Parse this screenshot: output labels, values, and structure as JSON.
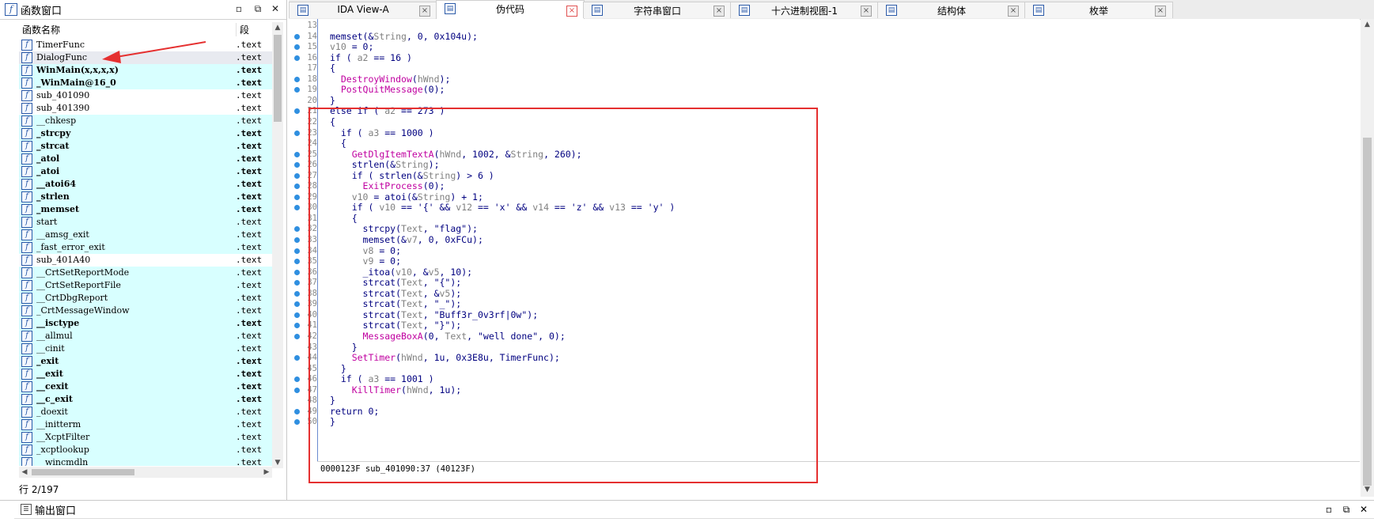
{
  "function_panel": {
    "title": "函数窗口",
    "columns": {
      "name": "函数名称",
      "segment": "段"
    },
    "status": "行 2/197",
    "functions": [
      {
        "name": "TimerFunc",
        "segment": ".text",
        "bold": false,
        "highlight": false,
        "selected": false
      },
      {
        "name": "DialogFunc",
        "segment": ".text",
        "bold": false,
        "highlight": false,
        "selected": true
      },
      {
        "name": "WinMain(x,x,x,x)",
        "segment": ".text",
        "bold": true,
        "highlight": true,
        "selected": false
      },
      {
        "name": "_WinMain@16_0",
        "segment": ".text",
        "bold": true,
        "highlight": true,
        "selected": false
      },
      {
        "name": "sub_401090",
        "segment": ".text",
        "bold": false,
        "highlight": false,
        "selected": false
      },
      {
        "name": "sub_401390",
        "segment": ".text",
        "bold": false,
        "highlight": false,
        "selected": false
      },
      {
        "name": "__chkesp",
        "segment": ".text",
        "bold": false,
        "highlight": true,
        "selected": false
      },
      {
        "name": "_strcpy",
        "segment": ".text",
        "bold": true,
        "highlight": true,
        "selected": false
      },
      {
        "name": "_strcat",
        "segment": ".text",
        "bold": true,
        "highlight": true,
        "selected": false
      },
      {
        "name": "_atol",
        "segment": ".text",
        "bold": true,
        "highlight": true,
        "selected": false
      },
      {
        "name": "_atoi",
        "segment": ".text",
        "bold": true,
        "highlight": true,
        "selected": false
      },
      {
        "name": "__atoi64",
        "segment": ".text",
        "bold": true,
        "highlight": true,
        "selected": false
      },
      {
        "name": "_strlen",
        "segment": ".text",
        "bold": true,
        "highlight": true,
        "selected": false
      },
      {
        "name": "_memset",
        "segment": ".text",
        "bold": true,
        "highlight": true,
        "selected": false
      },
      {
        "name": "start",
        "segment": ".text",
        "bold": false,
        "highlight": true,
        "selected": false
      },
      {
        "name": "__amsg_exit",
        "segment": ".text",
        "bold": false,
        "highlight": true,
        "selected": false
      },
      {
        "name": "_fast_error_exit",
        "segment": ".text",
        "bold": false,
        "highlight": true,
        "selected": false
      },
      {
        "name": "sub_401A40",
        "segment": ".text",
        "bold": false,
        "highlight": false,
        "selected": false
      },
      {
        "name": "__CrtSetReportMode",
        "segment": ".text",
        "bold": false,
        "highlight": true,
        "selected": false
      },
      {
        "name": "__CrtSetReportFile",
        "segment": ".text",
        "bold": false,
        "highlight": true,
        "selected": false
      },
      {
        "name": "__CrtDbgReport",
        "segment": ".text",
        "bold": false,
        "highlight": true,
        "selected": false
      },
      {
        "name": "_CrtMessageWindow",
        "segment": ".text",
        "bold": false,
        "highlight": true,
        "selected": false
      },
      {
        "name": "__isctype",
        "segment": ".text",
        "bold": true,
        "highlight": true,
        "selected": false
      },
      {
        "name": "__allmul",
        "segment": ".text",
        "bold": false,
        "highlight": true,
        "selected": false
      },
      {
        "name": "__cinit",
        "segment": ".text",
        "bold": false,
        "highlight": true,
        "selected": false
      },
      {
        "name": "_exit",
        "segment": ".text",
        "bold": true,
        "highlight": true,
        "selected": false
      },
      {
        "name": "__exit",
        "segment": ".text",
        "bold": true,
        "highlight": true,
        "selected": false
      },
      {
        "name": "__cexit",
        "segment": ".text",
        "bold": true,
        "highlight": true,
        "selected": false
      },
      {
        "name": "__c_exit",
        "segment": ".text",
        "bold": true,
        "highlight": true,
        "selected": false
      },
      {
        "name": "_doexit",
        "segment": ".text",
        "bold": false,
        "highlight": true,
        "selected": false
      },
      {
        "name": "__initterm",
        "segment": ".text",
        "bold": false,
        "highlight": true,
        "selected": false
      },
      {
        "name": "__XcptFilter",
        "segment": ".text",
        "bold": false,
        "highlight": true,
        "selected": false
      },
      {
        "name": "_xcptlookup",
        "segment": ".text",
        "bold": false,
        "highlight": true,
        "selected": false
      },
      {
        "name": "__wincmdln",
        "segment": ".text",
        "bold": false,
        "highlight": true,
        "selected": false
      }
    ]
  },
  "tabs": [
    {
      "label": "IDA View-A",
      "icon": "ida-view-icon",
      "active": false
    },
    {
      "label": "伪代码",
      "icon": "pseudocode-icon",
      "active": true
    },
    {
      "label": "字符串窗口",
      "icon": "strings-icon",
      "active": false
    },
    {
      "label": "十六进制视图-1",
      "icon": "hex-view-icon",
      "active": false
    },
    {
      "label": "结构体",
      "icon": "structures-icon",
      "active": false
    },
    {
      "label": "枚举",
      "icon": "enums-icon",
      "active": false
    }
  ],
  "code": {
    "status": "0000123F sub_401090:37 (40123F)",
    "lines": [
      {
        "num": "13",
        "dot": false,
        "html": ""
      },
      {
        "num": "14",
        "dot": true,
        "html": "memset(&String, 0, 0x104u);"
      },
      {
        "num": "15",
        "dot": true,
        "html": "v10 = 0;"
      },
      {
        "num": "16",
        "dot": true,
        "html": "if ( a2 == 16 )"
      },
      {
        "num": "17",
        "dot": false,
        "html": "{"
      },
      {
        "num": "18",
        "dot": true,
        "html": "  DestroyWindow(hWnd);"
      },
      {
        "num": "19",
        "dot": true,
        "html": "  PostQuitMessage(0);"
      },
      {
        "num": "20",
        "dot": false,
        "html": "}"
      },
      {
        "num": "21",
        "dot": true,
        "html": "else if ( a2 == 273 )"
      },
      {
        "num": "22",
        "dot": false,
        "html": "{"
      },
      {
        "num": "23",
        "dot": true,
        "html": "  if ( a3 == 1000 )"
      },
      {
        "num": "24",
        "dot": false,
        "html": "  {"
      },
      {
        "num": "25",
        "dot": true,
        "html": "    GetDlgItemTextA(hWnd, 1002, &String, 260);"
      },
      {
        "num": "26",
        "dot": true,
        "html": "    strlen(&String);"
      },
      {
        "num": "27",
        "dot": true,
        "html": "    if ( strlen(&String) > 6 )"
      },
      {
        "num": "28",
        "dot": true,
        "html": "      ExitProcess(0);"
      },
      {
        "num": "29",
        "dot": true,
        "html": "    v10 = atoi(&String) + 1;"
      },
      {
        "num": "30",
        "dot": true,
        "html": "    if ( v10 == '{' && v12 == 'x' && v14 == 'z' && v13 == 'y' )"
      },
      {
        "num": "31",
        "dot": false,
        "html": "    {"
      },
      {
        "num": "32",
        "dot": true,
        "html": "      strcpy(Text, \"flag\");"
      },
      {
        "num": "33",
        "dot": true,
        "html": "      memset(&v7, 0, 0xFCu);"
      },
      {
        "num": "34",
        "dot": true,
        "html": "      v8 = 0;"
      },
      {
        "num": "35",
        "dot": true,
        "html": "      v9 = 0;"
      },
      {
        "num": "36",
        "dot": true,
        "html": "      _itoa(v10, &v5, 10);"
      },
      {
        "num": "37",
        "dot": true,
        "html": "      strcat(Text, \"{\");"
      },
      {
        "num": "38",
        "dot": true,
        "html": "      strcat(Text, &v5);"
      },
      {
        "num": "39",
        "dot": true,
        "html": "      strcat(Text, \"_\");"
      },
      {
        "num": "40",
        "dot": true,
        "html": "      strcat(Text, \"Buff3r_0v3rf|0w\");"
      },
      {
        "num": "41",
        "dot": true,
        "html": "      strcat(Text, \"}\");"
      },
      {
        "num": "42",
        "dot": true,
        "html": "      MessageBoxA(0, Text, \"well done\", 0);"
      },
      {
        "num": "43",
        "dot": false,
        "html": "    }"
      },
      {
        "num": "44",
        "dot": true,
        "html": "    SetTimer(hWnd, 1u, 0x3E8u, TimerFunc);"
      },
      {
        "num": "45",
        "dot": false,
        "html": "  }"
      },
      {
        "num": "46",
        "dot": true,
        "html": "  if ( a3 == 1001 )"
      },
      {
        "num": "47",
        "dot": true,
        "html": "    KillTimer(hWnd, 1u);"
      },
      {
        "num": "48",
        "dot": false,
        "html": "}"
      },
      {
        "num": "49",
        "dot": true,
        "html": "return 0;"
      },
      {
        "num": "50",
        "dot": true,
        "html": "}"
      }
    ]
  },
  "output_panel": {
    "title": "输出窗口"
  },
  "colors": {
    "accent": "#2f8fe0",
    "highlight_row": "#d8ffff",
    "annotation_red": "#e53030",
    "function_call": "#c000a0",
    "variable": "#808080"
  }
}
